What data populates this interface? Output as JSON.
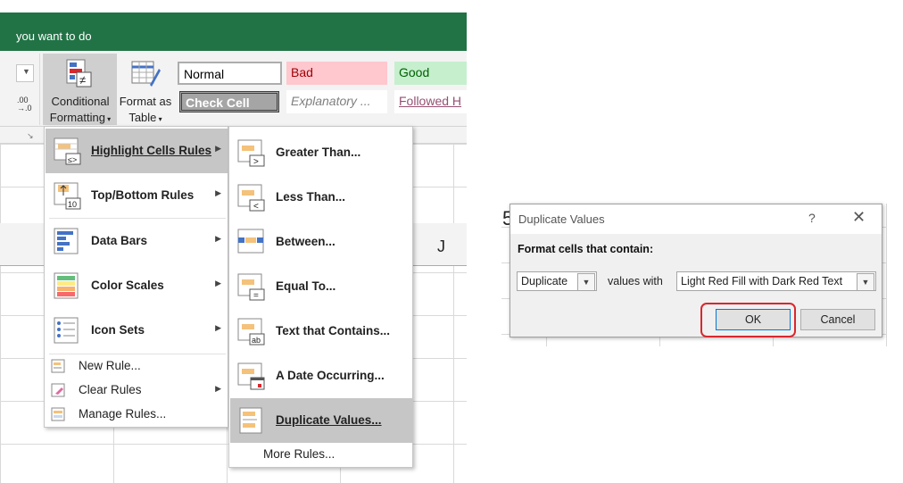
{
  "ribbon": {
    "tell_me": "you want to do",
    "decimal_label": ".00\n→.0",
    "conditional_formatting": {
      "line1": "Conditional",
      "line2": "Formatting"
    },
    "format_as_table": {
      "line1": "Format as",
      "line2": "Table"
    },
    "styles": {
      "normal": "Normal",
      "bad": "Bad",
      "good": "Good",
      "check_cell": "Check Cell",
      "explanatory": "Explanatory ...",
      "followed": "Followed H"
    },
    "column_header": "J"
  },
  "cf_menu": {
    "items": [
      {
        "label": "Highlight Cells Rules",
        "icon": "highlight-cells-icon"
      },
      {
        "label": "Top/Bottom Rules",
        "icon": "top-bottom-icon"
      },
      {
        "label": "Data Bars",
        "icon": "data-bars-icon"
      },
      {
        "label": "Color Scales",
        "icon": "color-scales-icon"
      },
      {
        "label": "Icon Sets",
        "icon": "icon-sets-icon"
      }
    ],
    "small_items": [
      {
        "label": "New Rule...",
        "icon": "new-rule-icon"
      },
      {
        "label": "Clear Rules",
        "icon": "clear-rules-icon"
      },
      {
        "label": "Manage Rules...",
        "icon": "manage-rules-icon"
      }
    ]
  },
  "highlight_submenu": {
    "items": [
      {
        "label": "Greater Than...",
        "icon": "greater-than-icon"
      },
      {
        "label": "Less Than...",
        "icon": "less-than-icon"
      },
      {
        "label": "Between...",
        "icon": "between-icon"
      },
      {
        "label": "Equal To...",
        "icon": "equal-to-icon"
      },
      {
        "label": "Text that Contains...",
        "icon": "text-contains-icon"
      },
      {
        "label": "A Date Occurring...",
        "icon": "date-occurring-icon"
      },
      {
        "label": "Duplicate Values...",
        "icon": "duplicate-values-icon"
      }
    ],
    "more": "More Rules..."
  },
  "dialog": {
    "title": "Duplicate Values",
    "help": "?",
    "close": "✕",
    "heading": "Format cells that contain:",
    "type_value": "Duplicate",
    "values_with": "values with",
    "format_value": "Light Red Fill with Dark Red Text",
    "ok": "OK",
    "cancel": "Cancel"
  },
  "background_sheet": {
    "cell_text": "5"
  },
  "colors": {
    "excel_green": "#217346",
    "highlight": "#d9272e",
    "menu_hover": "#c6c6c6"
  }
}
